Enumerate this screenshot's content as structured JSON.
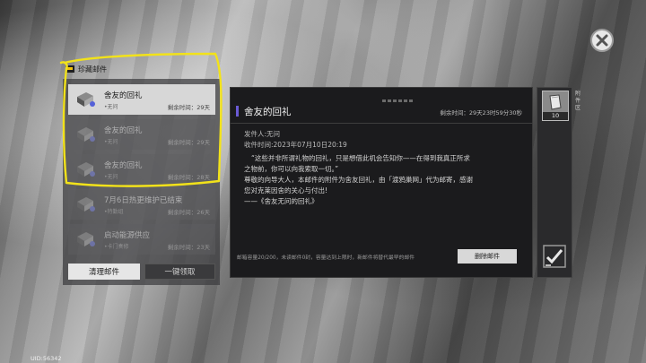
{
  "close": {
    "icon": "close-x-icon"
  },
  "tab": {
    "label": "珍藏邮件",
    "icon": "mail-folder-icon"
  },
  "mail_list": [
    {
      "title": "舍友的回礼",
      "sender": "•无问",
      "remain": "剩余时间：29天",
      "selected": true,
      "faded": false,
      "icon": "envelope-icon"
    },
    {
      "title": "舍友的回礼",
      "sender": "•无问",
      "remain": "剩余时间：29天",
      "selected": false,
      "faded": true,
      "icon": "envelope-icon"
    },
    {
      "title": "舍友的回礼",
      "sender": "•无问",
      "remain": "剩余时间：28天",
      "selected": false,
      "faded": true,
      "icon": "envelope-icon"
    },
    {
      "title": "7月6日热更维护已结束",
      "sender": "•特勤组",
      "remain": "剩余时间：26天",
      "selected": false,
      "faded": true,
      "icon": "envelope-icon"
    },
    {
      "title": "启动能源供应",
      "sender": "•卡门奏修",
      "remain": "剩余时间：23天",
      "selected": false,
      "faded": true,
      "icon": "envelope-icon"
    }
  ],
  "buttons": {
    "clean": "清理邮件",
    "claim_all": "一键领取",
    "delete": "删除邮件"
  },
  "detail": {
    "title": "舍友的回礼",
    "expire": "剩余时间：29天23时59分30秒",
    "sender": "发件人:无问",
    "received": "收件时间:2023年07月10日20:19",
    "body": [
      "“这些并非所谓礼物的回礼，只是想借此机会告知你——在得到我真正所求",
      "之物前，你可以向我索取一切。”",
      "尊敬的向导大人，本邮件的附件为舍友回礼，由「渡鸦巢网」代为邮寄，感谢",
      "您对克莱因舍的关心与付出!",
      "——《舍友无问的回礼》"
    ],
    "capacity": "邮箱容量20/200，未读邮件0封，容量达到上限时，新邮件将替代最早的邮件"
  },
  "attachment": {
    "label": "附件区",
    "count": "10",
    "icon": "paper-item-icon",
    "confirm_icon": "checkmark-icon"
  },
  "uid": "UID:56342",
  "colors": {
    "accent": "#6b5bd6",
    "annotation": "#f2e21a"
  }
}
